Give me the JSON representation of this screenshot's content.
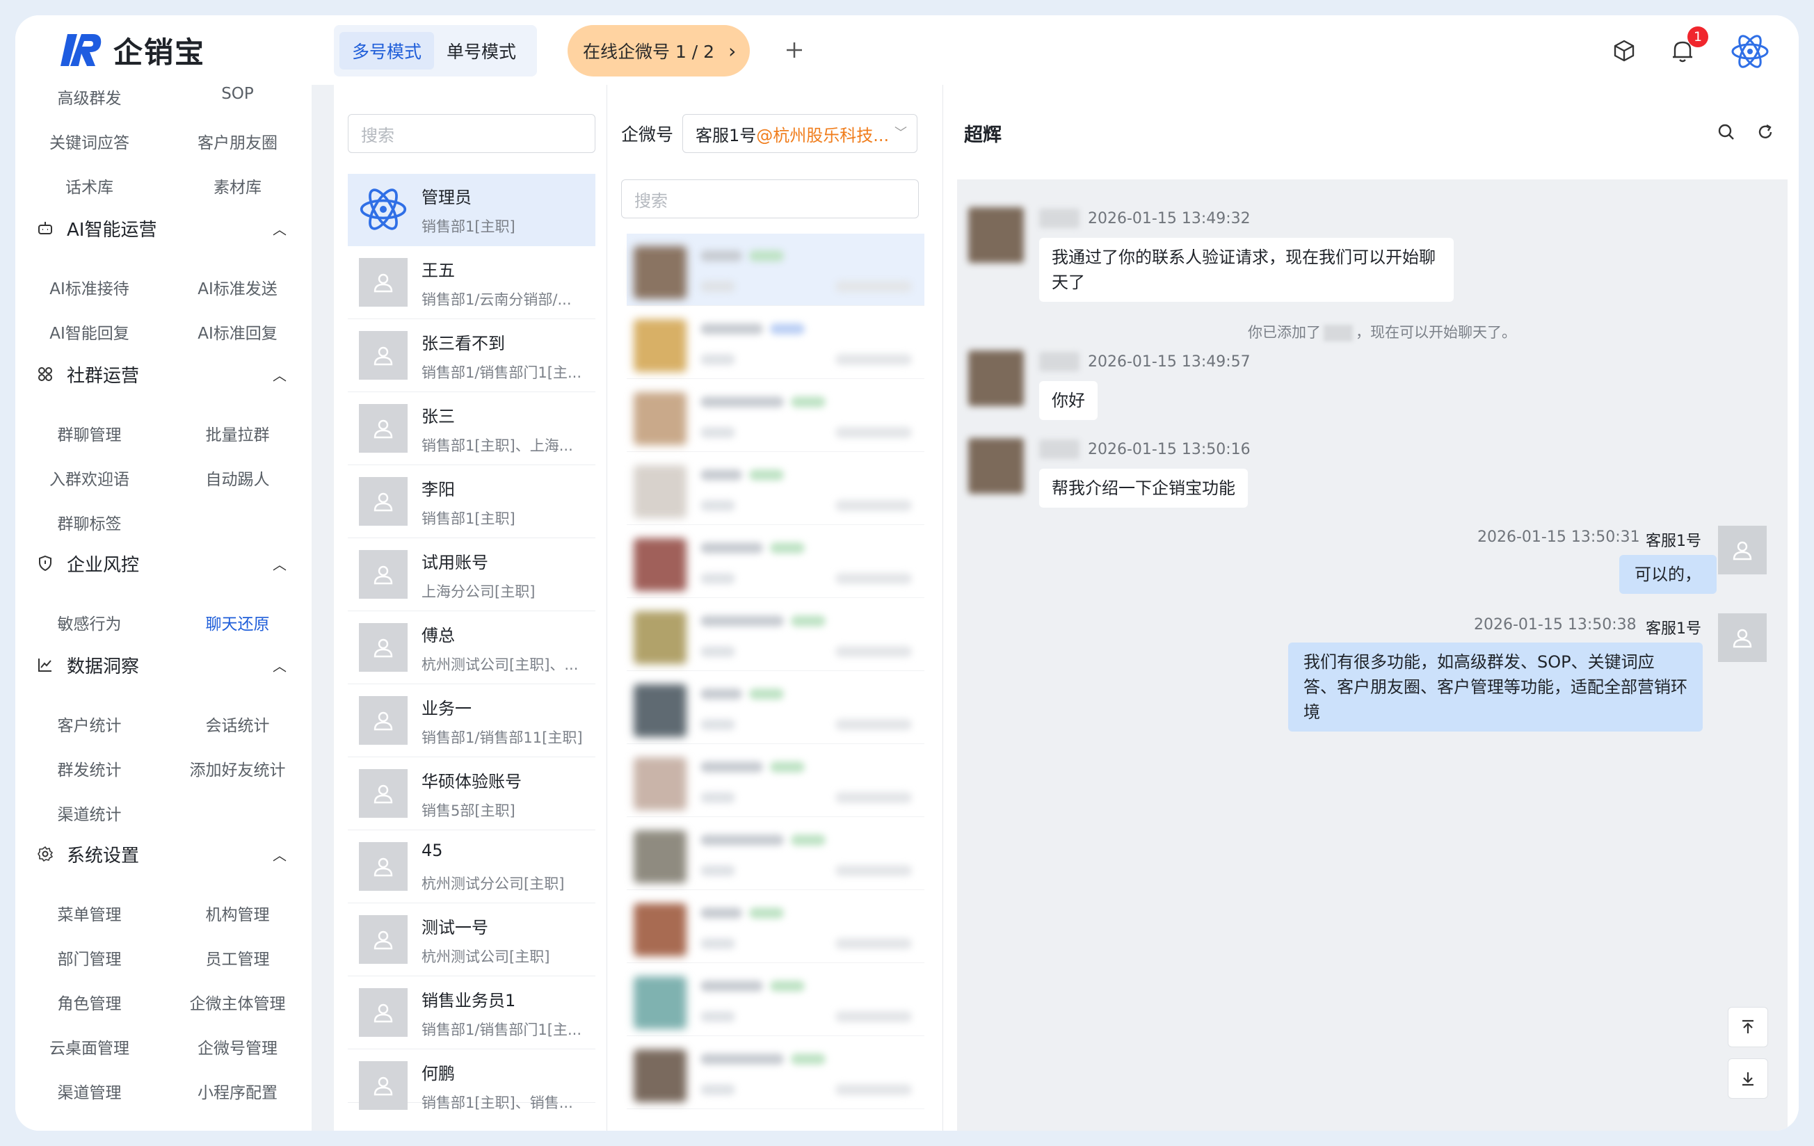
{
  "app": {
    "brand_name": "企销宝"
  },
  "topbar": {
    "modes": [
      "多号模式",
      "单号模式"
    ],
    "active_mode": "多号模式",
    "online_label": "在线企微号 1 / 2",
    "notification_count": "1"
  },
  "sidebar": {
    "rows_top": [
      [
        "高级群发",
        "SOP"
      ],
      [
        "关键词应答",
        "客户朋友圈"
      ],
      [
        "话术库",
        "素材库"
      ]
    ],
    "sections": [
      {
        "title": "AI智能运营",
        "icon": "robot-icon",
        "items": [
          [
            "AI标准接待",
            "AI标准发送"
          ],
          [
            "AI智能回复",
            "AI标准回复"
          ]
        ]
      },
      {
        "title": "社群运营",
        "icon": "community-icon",
        "items": [
          [
            "群聊管理",
            "批量拉群"
          ],
          [
            "入群欢迎语",
            "自动踢人"
          ],
          [
            "群聊标签",
            ""
          ]
        ]
      },
      {
        "title": "企业风控",
        "icon": "shield-icon",
        "items": [
          [
            "敏感行为",
            "聊天还原"
          ]
        ]
      },
      {
        "title": "数据洞察",
        "icon": "chart-icon",
        "items": [
          [
            "客户统计",
            "会话统计"
          ],
          [
            "群发统计",
            "添加好友统计"
          ],
          [
            "渠道统计",
            ""
          ]
        ]
      },
      {
        "title": "系统设置",
        "icon": "gear-icon",
        "items": [
          [
            "菜单管理",
            "机构管理"
          ],
          [
            "部门管理",
            "员工管理"
          ],
          [
            "角色管理",
            "企微主体管理"
          ],
          [
            "云桌面管理",
            "企微号管理"
          ],
          [
            "渠道管理",
            "小程序配置"
          ]
        ]
      }
    ],
    "active_item": "聊天还原"
  },
  "staff": {
    "search_placeholder": "搜索",
    "list": [
      {
        "name": "管理员",
        "dept": "销售部1[主职]"
      },
      {
        "name": "王五",
        "dept": "销售部1/云南分销部/..."
      },
      {
        "name": "张三看不到",
        "dept": "销售部1/销售部门1[主..."
      },
      {
        "name": "张三",
        "dept": "销售部1[主职]、上海..."
      },
      {
        "name": "李阳",
        "dept": "销售部1[主职]"
      },
      {
        "name": "试用账号",
        "dept": "上海分公司[主职]"
      },
      {
        "name": "傅总",
        "dept": "杭州测试公司[主职]、..."
      },
      {
        "name": "业务一",
        "dept": "销售部1/销售部11[主职]"
      },
      {
        "name": "华硕体验账号",
        "dept": "销售5部[主职]"
      },
      {
        "name": "45",
        "dept": "杭州测试分公司[主职]"
      },
      {
        "name": "测试一号",
        "dept": "杭州测试公司[主职]"
      },
      {
        "name": "销售业务员1",
        "dept": "销售部1/销售部门1[主..."
      },
      {
        "name": "何鹏",
        "dept": "销售部1[主职]、销售..."
      }
    ]
  },
  "contacts": {
    "account_label": "企微号",
    "account_name": "客服1号",
    "account_org": "@杭州股乐科技...",
    "search_placeholder": "搜索"
  },
  "chat": {
    "title": "超辉",
    "messages": [
      {
        "side": "left",
        "time": "2026-01-15 13:49:32",
        "text": "我通过了你的联系人验证请求，现在我们可以开始聊天了"
      },
      {
        "side": "left",
        "time": "2026-01-15 13:49:57",
        "text": "你好"
      },
      {
        "side": "left",
        "time": "2026-01-15 13:50:16",
        "text": "帮我介绍一下企销宝功能"
      },
      {
        "side": "right",
        "time": "2026-01-15 13:50:31",
        "sender": "客服1号",
        "text": "可以的，"
      },
      {
        "side": "right",
        "time": "2026-01-15 13:50:38",
        "sender": "客服1号",
        "text": "我们有很多功能，如高级群发、SOP、关键词应答、客户朋友圈、客户管理等功能，适配全部营销环境"
      }
    ],
    "system_note_prefix": "你已添加了",
    "system_note_suffix": "，现在可以开始聊天了。"
  },
  "colors": {
    "accent": "#1f5ed9",
    "online_pill": "#ffd3a1",
    "right_bubble": "#cce1fb",
    "org_orange": "#f07d1c"
  }
}
